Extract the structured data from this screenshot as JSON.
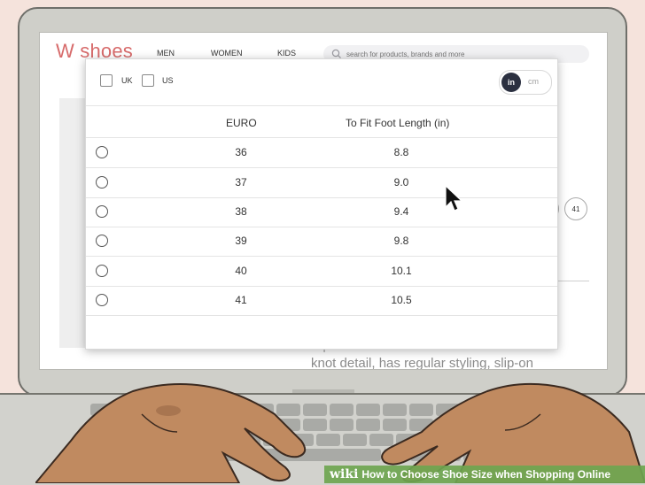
{
  "site": {
    "logo": "W shoes",
    "nav": [
      "MEN",
      "WOMEN",
      "KIDS"
    ],
    "search_placeholder": "search for products, brands and more"
  },
  "modal": {
    "checkboxes": [
      {
        "label": "UK",
        "checked": false
      },
      {
        "label": "US",
        "checked": false
      }
    ],
    "unit_toggle": {
      "selected": "in",
      "other": "cm"
    },
    "columns": [
      "EURO",
      "To Fit Foot Length (in)"
    ],
    "rows": [
      {
        "euro": "36",
        "length": "8.8"
      },
      {
        "euro": "37",
        "length": "9.0"
      },
      {
        "euro": "38",
        "length": "9.4"
      },
      {
        "euro": "39",
        "length": "9.8"
      },
      {
        "euro": "40",
        "length": "10.1"
      },
      {
        "euro": "41",
        "length": "10.5"
      }
    ]
  },
  "background": {
    "size_chip": "41",
    "description_lines": [
      "A pair of black round-toe ballerinas with",
      "knot detail, has regular styling, slip-on"
    ]
  },
  "caption": {
    "logo": "wiki",
    "text": "How to Choose Shoe Size when Shopping Online"
  },
  "colors": {
    "brand": "#d76b6b",
    "toggle_active": "#2b3040",
    "caption_bar": "#6ea550"
  }
}
